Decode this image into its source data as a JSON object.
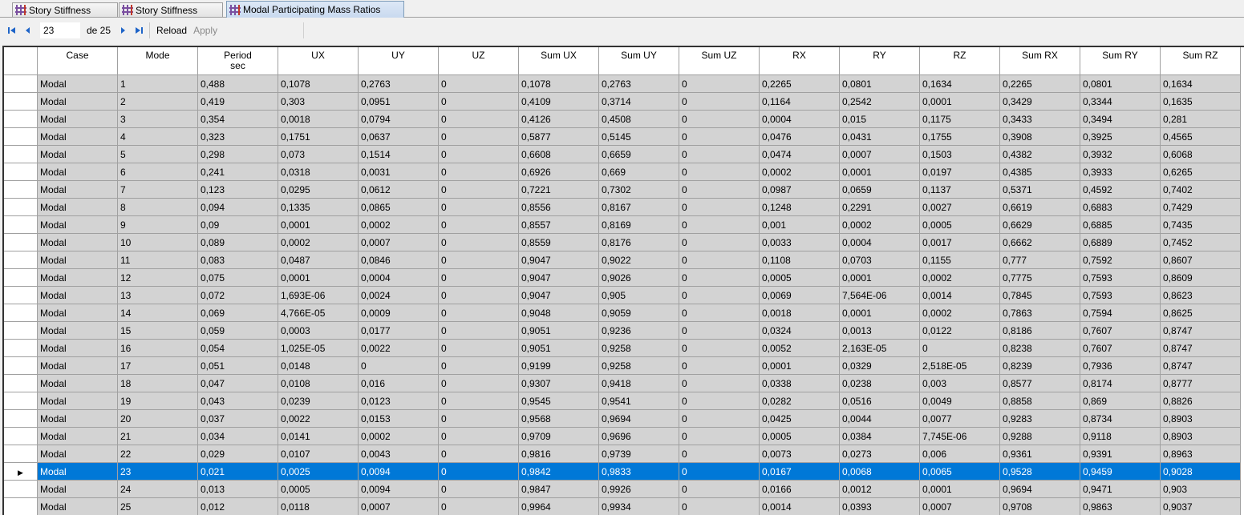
{
  "tabs": [
    {
      "label": "Story Stiffness",
      "active": false
    },
    {
      "label": "Story Stiffness",
      "active": false
    },
    {
      "label": "Modal Participating Mass Ratios",
      "active": true
    }
  ],
  "toolbar": {
    "current_page": "23",
    "page_of": "de 25",
    "reload_label": "Reload",
    "apply_label": "Apply"
  },
  "table": {
    "headers": [
      "Case",
      "Mode",
      "Period",
      "UX",
      "UY",
      "UZ",
      "Sum UX",
      "Sum UY",
      "Sum UZ",
      "RX",
      "RY",
      "RZ",
      "Sum RX",
      "Sum RY",
      "Sum RZ"
    ],
    "period_unit": "sec",
    "selected_row": 23,
    "rows": [
      [
        "Modal",
        "1",
        "0,488",
        "0,1078",
        "0,2763",
        "0",
        "0,1078",
        "0,2763",
        "0",
        "0,2265",
        "0,0801",
        "0,1634",
        "0,2265",
        "0,0801",
        "0,1634"
      ],
      [
        "Modal",
        "2",
        "0,419",
        "0,303",
        "0,0951",
        "0",
        "0,4109",
        "0,3714",
        "0",
        "0,1164",
        "0,2542",
        "0,0001",
        "0,3429",
        "0,3344",
        "0,1635"
      ],
      [
        "Modal",
        "3",
        "0,354",
        "0,0018",
        "0,0794",
        "0",
        "0,4126",
        "0,4508",
        "0",
        "0,0004",
        "0,015",
        "0,1175",
        "0,3433",
        "0,3494",
        "0,281"
      ],
      [
        "Modal",
        "4",
        "0,323",
        "0,1751",
        "0,0637",
        "0",
        "0,5877",
        "0,5145",
        "0",
        "0,0476",
        "0,0431",
        "0,1755",
        "0,3908",
        "0,3925",
        "0,4565"
      ],
      [
        "Modal",
        "5",
        "0,298",
        "0,073",
        "0,1514",
        "0",
        "0,6608",
        "0,6659",
        "0",
        "0,0474",
        "0,0007",
        "0,1503",
        "0,4382",
        "0,3932",
        "0,6068"
      ],
      [
        "Modal",
        "6",
        "0,241",
        "0,0318",
        "0,0031",
        "0",
        "0,6926",
        "0,669",
        "0",
        "0,0002",
        "0,0001",
        "0,0197",
        "0,4385",
        "0,3933",
        "0,6265"
      ],
      [
        "Modal",
        "7",
        "0,123",
        "0,0295",
        "0,0612",
        "0",
        "0,7221",
        "0,7302",
        "0",
        "0,0987",
        "0,0659",
        "0,1137",
        "0,5371",
        "0,4592",
        "0,7402"
      ],
      [
        "Modal",
        "8",
        "0,094",
        "0,1335",
        "0,0865",
        "0",
        "0,8556",
        "0,8167",
        "0",
        "0,1248",
        "0,2291",
        "0,0027",
        "0,6619",
        "0,6883",
        "0,7429"
      ],
      [
        "Modal",
        "9",
        "0,09",
        "0,0001",
        "0,0002",
        "0",
        "0,8557",
        "0,8169",
        "0",
        "0,001",
        "0,0002",
        "0,0005",
        "0,6629",
        "0,6885",
        "0,7435"
      ],
      [
        "Modal",
        "10",
        "0,089",
        "0,0002",
        "0,0007",
        "0",
        "0,8559",
        "0,8176",
        "0",
        "0,0033",
        "0,0004",
        "0,0017",
        "0,6662",
        "0,6889",
        "0,7452"
      ],
      [
        "Modal",
        "11",
        "0,083",
        "0,0487",
        "0,0846",
        "0",
        "0,9047",
        "0,9022",
        "0",
        "0,1108",
        "0,0703",
        "0,1155",
        "0,777",
        "0,7592",
        "0,8607"
      ],
      [
        "Modal",
        "12",
        "0,075",
        "0,0001",
        "0,0004",
        "0",
        "0,9047",
        "0,9026",
        "0",
        "0,0005",
        "0,0001",
        "0,0002",
        "0,7775",
        "0,7593",
        "0,8609"
      ],
      [
        "Modal",
        "13",
        "0,072",
        "1,693E-06",
        "0,0024",
        "0",
        "0,9047",
        "0,905",
        "0",
        "0,0069",
        "7,564E-06",
        "0,0014",
        "0,7845",
        "0,7593",
        "0,8623"
      ],
      [
        "Modal",
        "14",
        "0,069",
        "4,766E-05",
        "0,0009",
        "0",
        "0,9048",
        "0,9059",
        "0",
        "0,0018",
        "0,0001",
        "0,0002",
        "0,7863",
        "0,7594",
        "0,8625"
      ],
      [
        "Modal",
        "15",
        "0,059",
        "0,0003",
        "0,0177",
        "0",
        "0,9051",
        "0,9236",
        "0",
        "0,0324",
        "0,0013",
        "0,0122",
        "0,8186",
        "0,7607",
        "0,8747"
      ],
      [
        "Modal",
        "16",
        "0,054",
        "1,025E-05",
        "0,0022",
        "0",
        "0,9051",
        "0,9258",
        "0",
        "0,0052",
        "2,163E-05",
        "0",
        "0,8238",
        "0,7607",
        "0,8747"
      ],
      [
        "Modal",
        "17",
        "0,051",
        "0,0148",
        "0",
        "0",
        "0,9199",
        "0,9258",
        "0",
        "0,0001",
        "0,0329",
        "2,518E-05",
        "0,8239",
        "0,7936",
        "0,8747"
      ],
      [
        "Modal",
        "18",
        "0,047",
        "0,0108",
        "0,016",
        "0",
        "0,9307",
        "0,9418",
        "0",
        "0,0338",
        "0,0238",
        "0,003",
        "0,8577",
        "0,8174",
        "0,8777"
      ],
      [
        "Modal",
        "19",
        "0,043",
        "0,0239",
        "0,0123",
        "0",
        "0,9545",
        "0,9541",
        "0",
        "0,0282",
        "0,0516",
        "0,0049",
        "0,8858",
        "0,869",
        "0,8826"
      ],
      [
        "Modal",
        "20",
        "0,037",
        "0,0022",
        "0,0153",
        "0",
        "0,9568",
        "0,9694",
        "0",
        "0,0425",
        "0,0044",
        "0,0077",
        "0,9283",
        "0,8734",
        "0,8903"
      ],
      [
        "Modal",
        "21",
        "0,034",
        "0,0141",
        "0,0002",
        "0",
        "0,9709",
        "0,9696",
        "0",
        "0,0005",
        "0,0384",
        "7,745E-06",
        "0,9288",
        "0,9118",
        "0,8903"
      ],
      [
        "Modal",
        "22",
        "0,029",
        "0,0107",
        "0,0043",
        "0",
        "0,9816",
        "0,9739",
        "0",
        "0,0073",
        "0,0273",
        "0,006",
        "0,9361",
        "0,9391",
        "0,8963"
      ],
      [
        "Modal",
        "23",
        "0,021",
        "0,0025",
        "0,0094",
        "0",
        "0,9842",
        "0,9833",
        "0",
        "0,0167",
        "0,0068",
        "0,0065",
        "0,9528",
        "0,9459",
        "0,9028"
      ],
      [
        "Modal",
        "24",
        "0,013",
        "0,0005",
        "0,0094",
        "0",
        "0,9847",
        "0,9926",
        "0",
        "0,0166",
        "0,0012",
        "0,0001",
        "0,9694",
        "0,9471",
        "0,903"
      ],
      [
        "Modal",
        "25",
        "0,012",
        "0,0118",
        "0,0007",
        "0",
        "0,9964",
        "0,9934",
        "0",
        "0,0014",
        "0,0393",
        "0,0007",
        "0,9708",
        "0,9863",
        "0,9037"
      ]
    ]
  },
  "colors": {
    "selection": "#0078d7",
    "cell_bg": "#d3d3d3",
    "nav_accent": "#1e64c8"
  }
}
